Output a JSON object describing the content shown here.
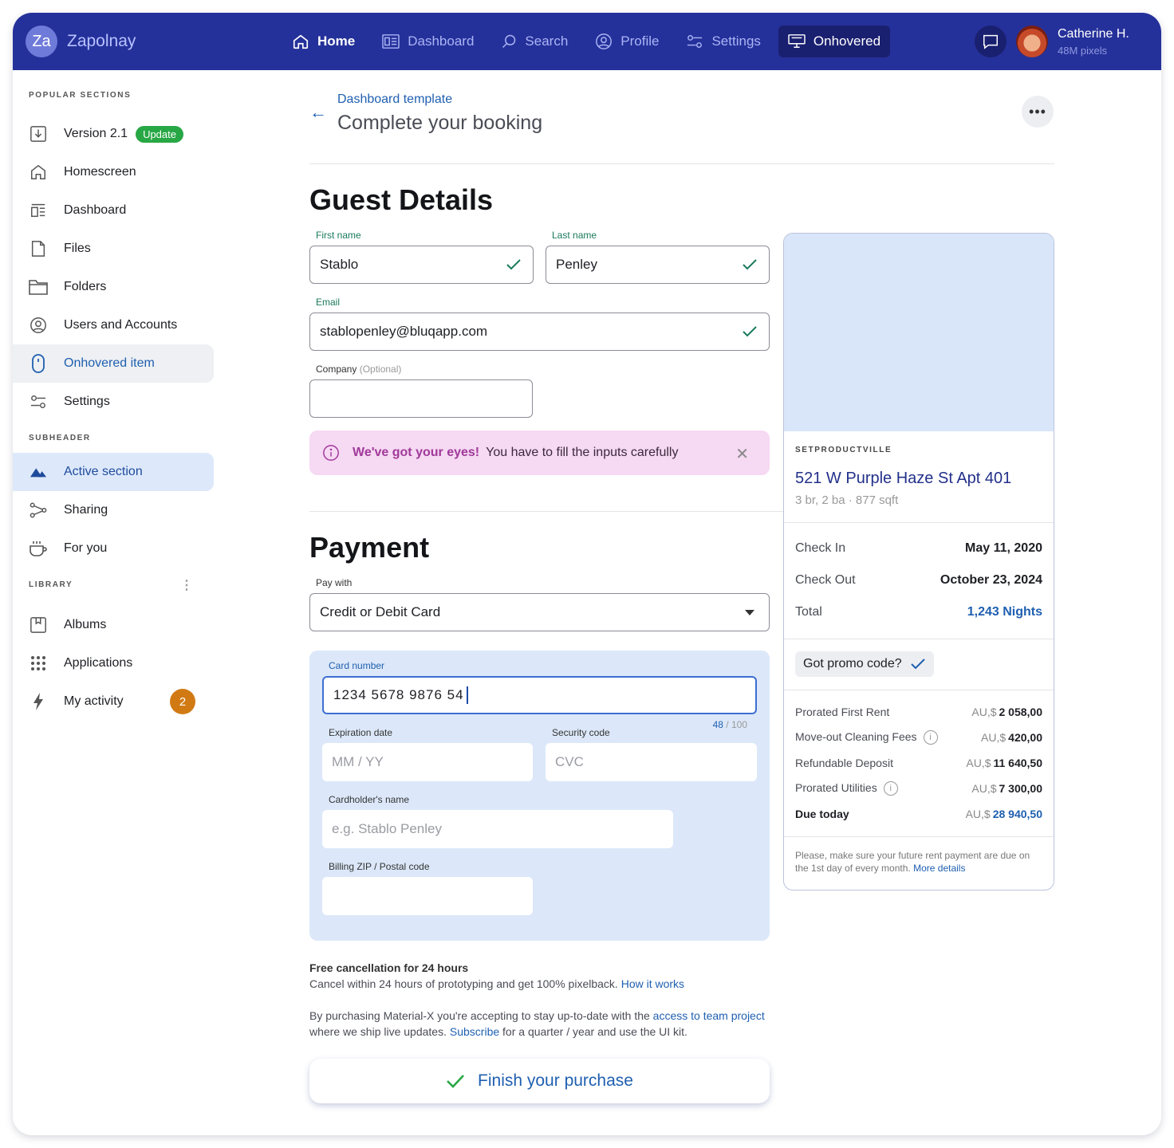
{
  "app": {
    "logo_initials": "Za",
    "name": "Zapolnay"
  },
  "nav": [
    {
      "label": "Home",
      "icon": "home-icon"
    },
    {
      "label": "Dashboard",
      "icon": "dashboard-icon"
    },
    {
      "label": "Search",
      "icon": "search-icon"
    },
    {
      "label": "Profile",
      "icon": "profile-icon"
    },
    {
      "label": "Settings",
      "icon": "settings-icon"
    },
    {
      "label": "Onhovered",
      "icon": "monitor-icon"
    }
  ],
  "user": {
    "name": "Catherine H.",
    "sub": "48M pixels"
  },
  "sidebar": {
    "popular_header": "POPULAR SECTIONS",
    "popular": [
      {
        "label": "Version 2.1",
        "badge": "Update"
      },
      {
        "label": "Homescreen"
      },
      {
        "label": "Dashboard"
      },
      {
        "label": "Files"
      },
      {
        "label": "Folders"
      },
      {
        "label": "Users and Accounts"
      },
      {
        "label": "Onhovered item"
      },
      {
        "label": "Settings"
      }
    ],
    "sub_header": "SUBHEADER",
    "sub": [
      {
        "label": "Active section"
      },
      {
        "label": "Sharing"
      },
      {
        "label": "For you"
      }
    ],
    "library_header": "LIBRARY",
    "library": [
      {
        "label": "Albums"
      },
      {
        "label": "Applications"
      },
      {
        "label": "My activity",
        "count": "2"
      }
    ]
  },
  "header": {
    "breadcrumb": "Dashboard template",
    "title": "Complete your booking"
  },
  "guest": {
    "title": "Guest Details",
    "first_label": "First name",
    "first_value": "Stablo",
    "last_label": "Last name",
    "last_value": "Penley",
    "email_label": "Email",
    "email_value": "stablopenley@bluqapp.com",
    "company_label": "Company",
    "company_optional": "(Optional)",
    "company_value": ""
  },
  "alert": {
    "bold": "We've got your eyes!",
    "text": "You have to fill the inputs carefully"
  },
  "payment": {
    "title": "Payment",
    "pay_with_label": "Pay with",
    "pay_with_value": "Credit or Debit Card",
    "card_label": "Card number",
    "card_value": "1234 5678 9876 54",
    "counter_current": "48",
    "counter_max": "/ 100",
    "exp_label": "Expiration date",
    "exp_placeholder": "MM / YY",
    "sec_label": "Security code",
    "sec_placeholder": "CVC",
    "holder_label": "Cardholder's name",
    "holder_placeholder": "e.g. Stablo Penley",
    "zip_label": "Billing ZIP / Postal code",
    "zip_value": ""
  },
  "notes": {
    "cancel_title": "Free cancellation for 24 hours",
    "cancel_text": "Cancel within 24 hours of prototyping and get 100% pixelback.",
    "cancel_link": "How it works",
    "terms_1": "By purchasing Material-X you're accepting to stay up-to-date with the",
    "terms_link1": "access to team project",
    "terms_2": "where we ship live updates.",
    "terms_link2": "Subscribe",
    "terms_3": "for a quarter / year and use the UI kit."
  },
  "finish_label": "Finish your purchase",
  "summary": {
    "overline": "SETPRODUCTVILLE",
    "title": "521 W Purple Haze St Apt 401",
    "sub": "3 br, 2 ba · 877 sqft",
    "checkin_label": "Check In",
    "checkin_value": "May 11, 2020",
    "checkout_label": "Check Out",
    "checkout_value": "October 23, 2024",
    "total_label": "Total",
    "total_value": "1,243 Nights",
    "promo_label": "Got promo code?",
    "currency": "AU,$",
    "fees": [
      {
        "label": "Prorated First Rent",
        "amount": "2 058,00"
      },
      {
        "label": "Move-out Cleaning Fees",
        "amount": "420,00"
      },
      {
        "label": "Refundable Deposit",
        "amount": "11 640,50"
      },
      {
        "label": "Prorated Utilities",
        "amount": "7 300,00"
      },
      {
        "label": "Due today",
        "amount": "28 940,50"
      }
    ],
    "footer_text": "Please, make sure your future rent payment are due on the 1st day of every month.",
    "footer_link": "More details"
  },
  "colors": {
    "topbar": "#25319a",
    "accent": "#1f5fb0",
    "success": "#28a745",
    "alert_bg": "#f6d9f3",
    "card_bg": "#dce8f9",
    "count_badge": "#d17a14"
  }
}
